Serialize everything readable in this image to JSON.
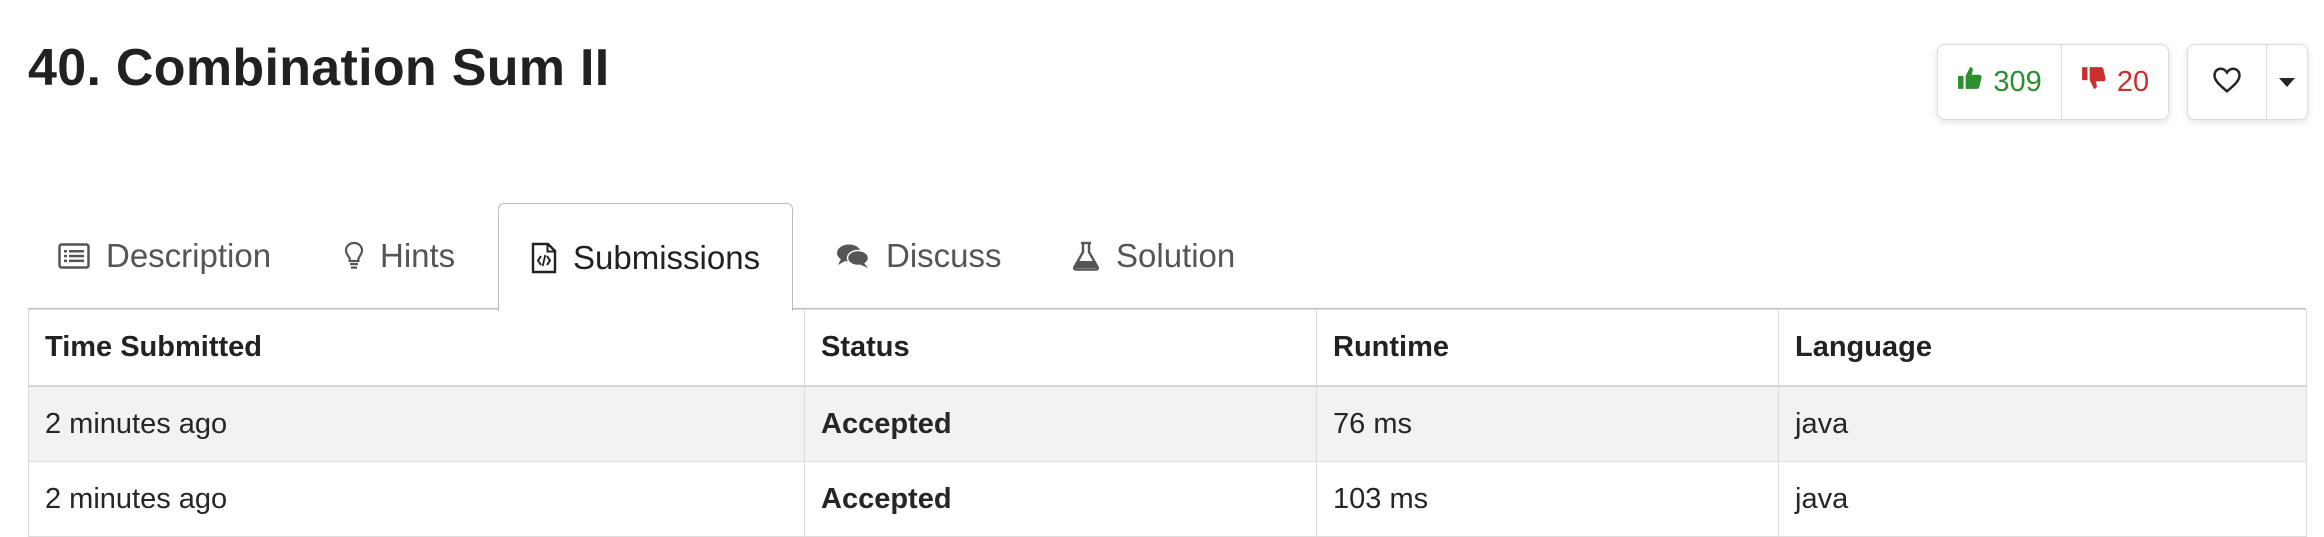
{
  "problem": {
    "title": "40. Combination Sum II"
  },
  "votes": {
    "likes": "309",
    "dislikes": "20"
  },
  "colors": {
    "accepted": "#2e8f2e",
    "like": "#2e8f2e",
    "dislike": "#c8302f"
  },
  "tabs": [
    {
      "label": "Description",
      "icon": "description-icon"
    },
    {
      "label": "Hints",
      "icon": "lightbulb-icon"
    },
    {
      "label": "Submissions",
      "icon": "code-file-icon",
      "active": true
    },
    {
      "label": "Discuss",
      "icon": "comments-icon"
    },
    {
      "label": "Solution",
      "icon": "flask-icon"
    }
  ],
  "table": {
    "headers": [
      "Time Submitted",
      "Status",
      "Runtime",
      "Language"
    ],
    "rows": [
      {
        "time": "2 minutes ago",
        "status": "Accepted",
        "runtime": "76 ms",
        "language": "java"
      },
      {
        "time": "2 minutes ago",
        "status": "Accepted",
        "runtime": "103 ms",
        "language": "java"
      }
    ]
  }
}
